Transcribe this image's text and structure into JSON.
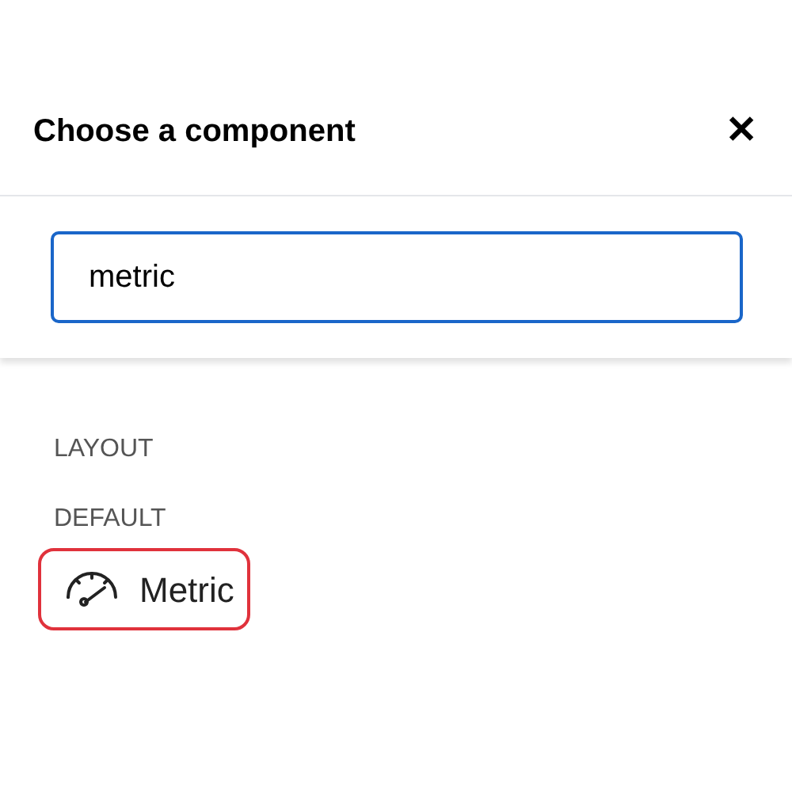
{
  "dialog": {
    "title": "Choose a component",
    "close": "✕"
  },
  "search": {
    "value": "metric"
  },
  "sections": [
    {
      "heading": "LAYOUT"
    },
    {
      "heading": "DEFAULT",
      "items": [
        {
          "label": "Metric",
          "highlighted": true
        }
      ]
    }
  ]
}
